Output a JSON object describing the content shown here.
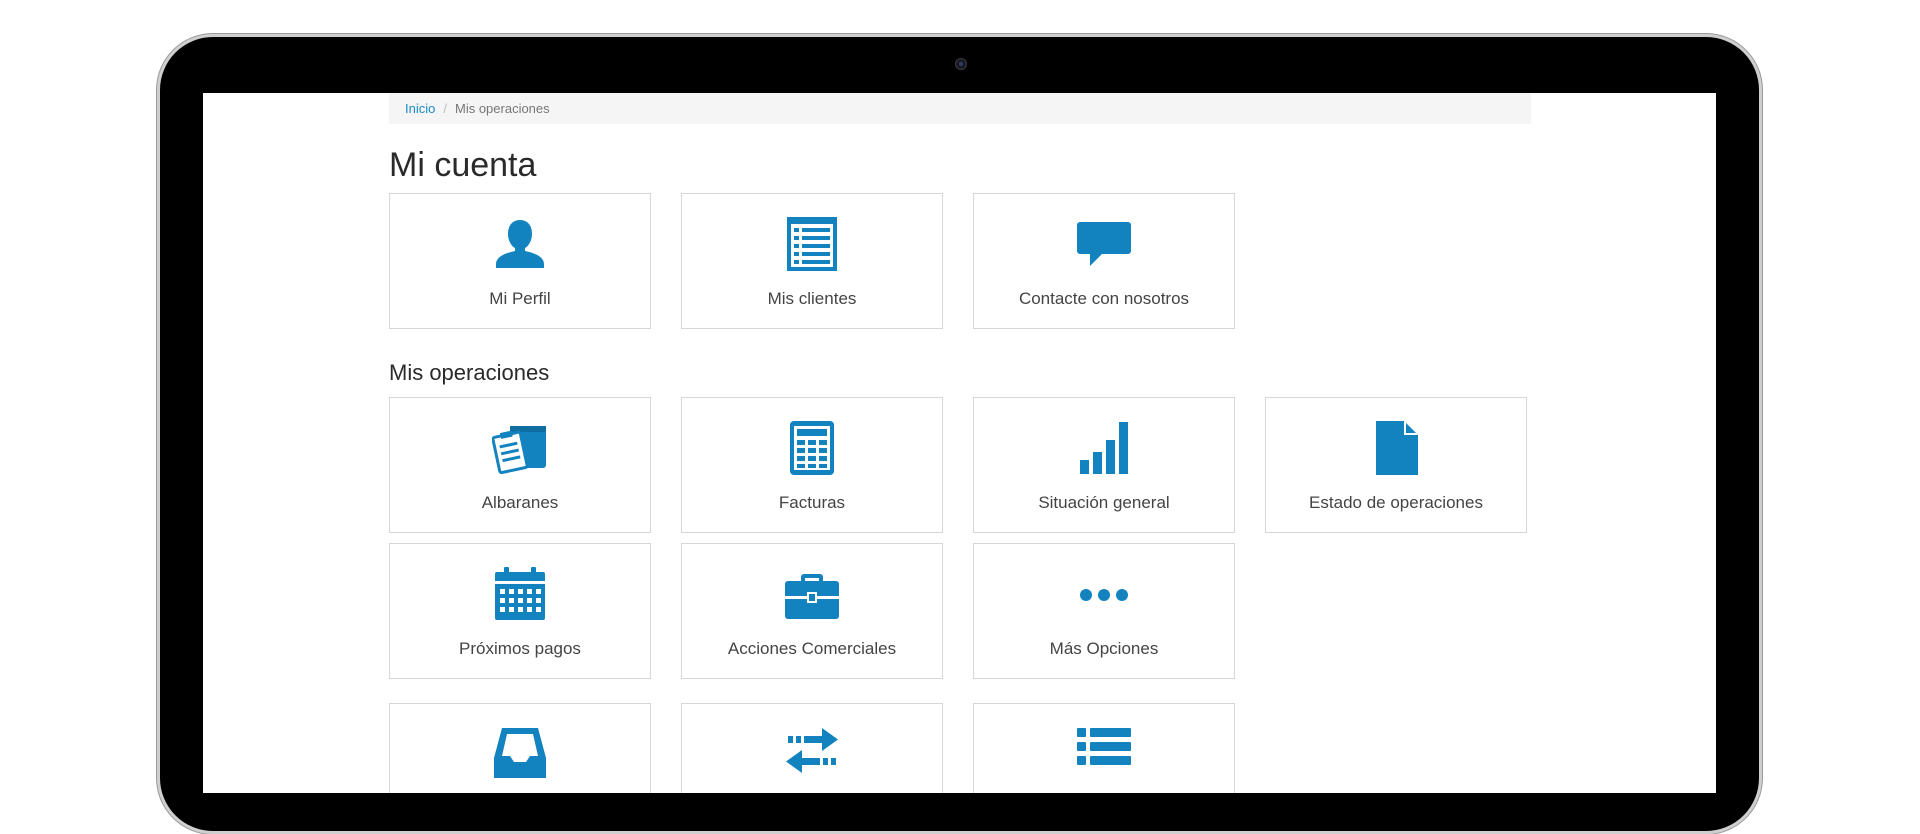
{
  "breadcrumb": {
    "home": "Inicio",
    "separator": "/",
    "current": "Mis operaciones"
  },
  "account": {
    "title": "Mi cuenta",
    "tiles": [
      {
        "label": "Mi Perfil",
        "icon": "user-icon"
      },
      {
        "label": "Mis clientes",
        "icon": "list-document-icon"
      },
      {
        "label": "Contacte con nosotros",
        "icon": "chat-bubble-icon"
      }
    ]
  },
  "operations": {
    "title": "Mis operaciones",
    "tiles": [
      {
        "label": "Albaranes",
        "icon": "clipboard-box-icon"
      },
      {
        "label": "Facturas",
        "icon": "calculator-icon"
      },
      {
        "label": "Situación general",
        "icon": "bar-chart-icon"
      },
      {
        "label": "Estado de operaciones",
        "icon": "file-icon"
      },
      {
        "label": "Próximos pagos",
        "icon": "calendar-icon"
      },
      {
        "label": "Acciones Comerciales",
        "icon": "briefcase-icon"
      },
      {
        "label": "Más Opciones",
        "icon": "more-dots-icon"
      },
      {
        "label": "",
        "icon": "inbox-tray-icon"
      },
      {
        "label": "",
        "icon": "transfer-arrows-icon"
      },
      {
        "label": "",
        "icon": "bullet-list-icon"
      }
    ]
  },
  "colors": {
    "accent": "#1383bf",
    "link": "#1b8bc4",
    "text": "#444444",
    "tile_border": "#d6d6d6",
    "breadcrumb_bg": "#f5f5f5",
    "device_frame": "#000000"
  }
}
